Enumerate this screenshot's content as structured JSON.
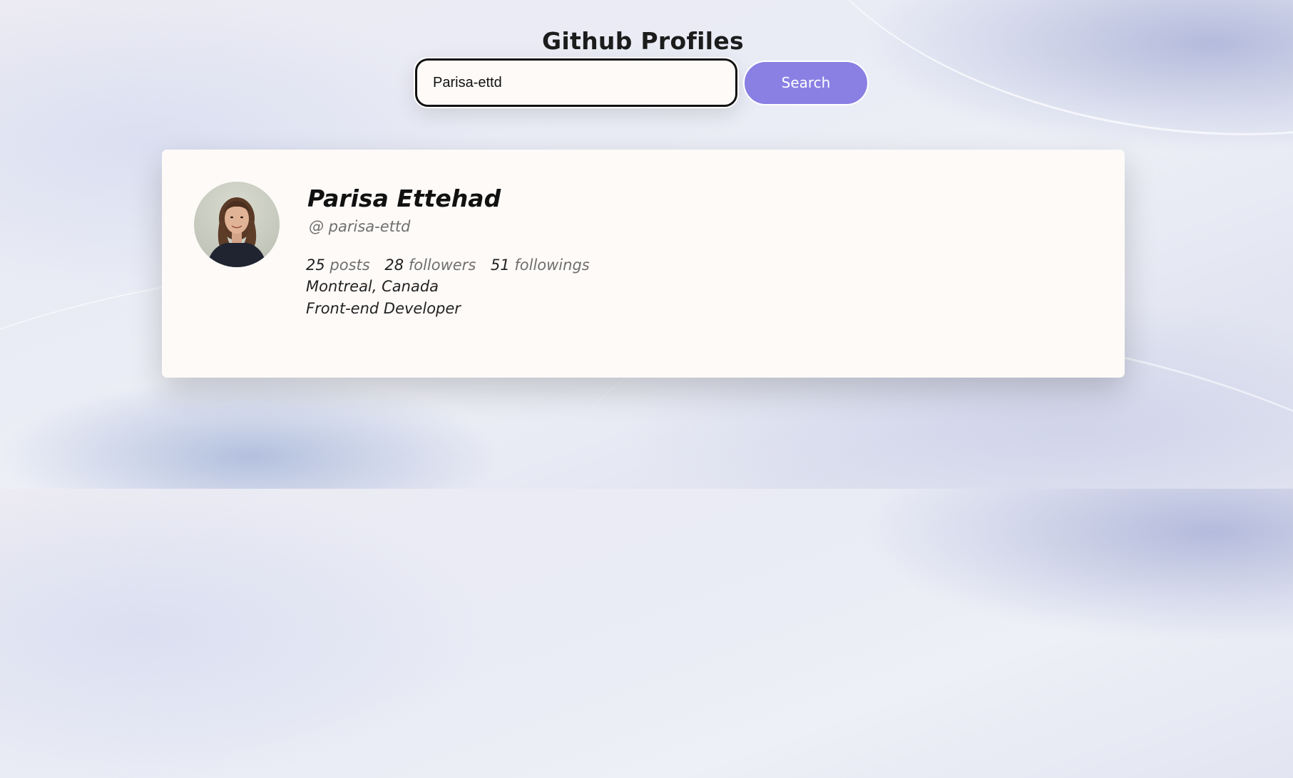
{
  "page": {
    "title": "Github Profiles"
  },
  "search": {
    "value": "Parisa-ettd",
    "button_label": "Search"
  },
  "profile": {
    "name": "Parisa Ettehad",
    "handle": "@ parisa-ettd",
    "stats": {
      "posts_count": "25",
      "posts_label": "posts",
      "followers_count": "28",
      "followers_label": "followers",
      "followings_count": "51",
      "followings_label": "followings"
    },
    "location": "Montreal, Canada",
    "bio": "Front-end Developer"
  },
  "colors": {
    "accent": "#8a7fe3",
    "card": "#fdfaf8",
    "text": "#111111",
    "muted": "#6f6f6f"
  }
}
